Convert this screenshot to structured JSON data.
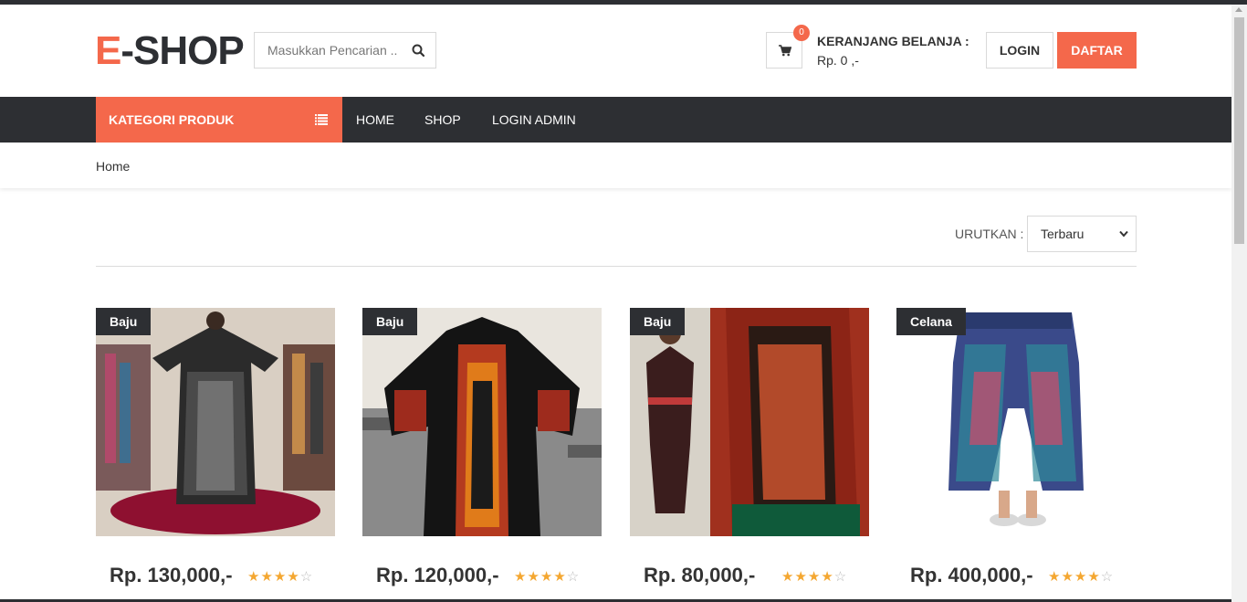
{
  "header": {
    "logo_prefix": "E",
    "logo_rest": "-SHOP",
    "search_placeholder": "Masukkan Pencarian ..",
    "cart_count": "0",
    "cart_title": "KERANJANG BELANJA :",
    "cart_total": "Rp. 0 ,-",
    "login_label": "LOGIN",
    "register_label": "DAFTAR"
  },
  "nav": {
    "category_label": "KATEGORI PRODUK",
    "links": [
      "HOME",
      "SHOP",
      "LOGIN ADMIN"
    ]
  },
  "breadcrumb": "Home",
  "sort": {
    "label": "URUTKAN :",
    "selected": "Terbaru"
  },
  "products": [
    {
      "tag": "Baju",
      "price": "Rp. 130,000,-",
      "rating": 4
    },
    {
      "tag": "Baju",
      "price": "Rp. 120,000,-",
      "rating": 4
    },
    {
      "tag": "Baju",
      "price": "Rp. 80,000,-",
      "rating": 4
    },
    {
      "tag": "Celana",
      "price": "Rp. 400,000,-",
      "rating": 4
    }
  ],
  "colors": {
    "accent": "#f4684b",
    "dark": "#2d2f33",
    "star": "#f4a731"
  }
}
